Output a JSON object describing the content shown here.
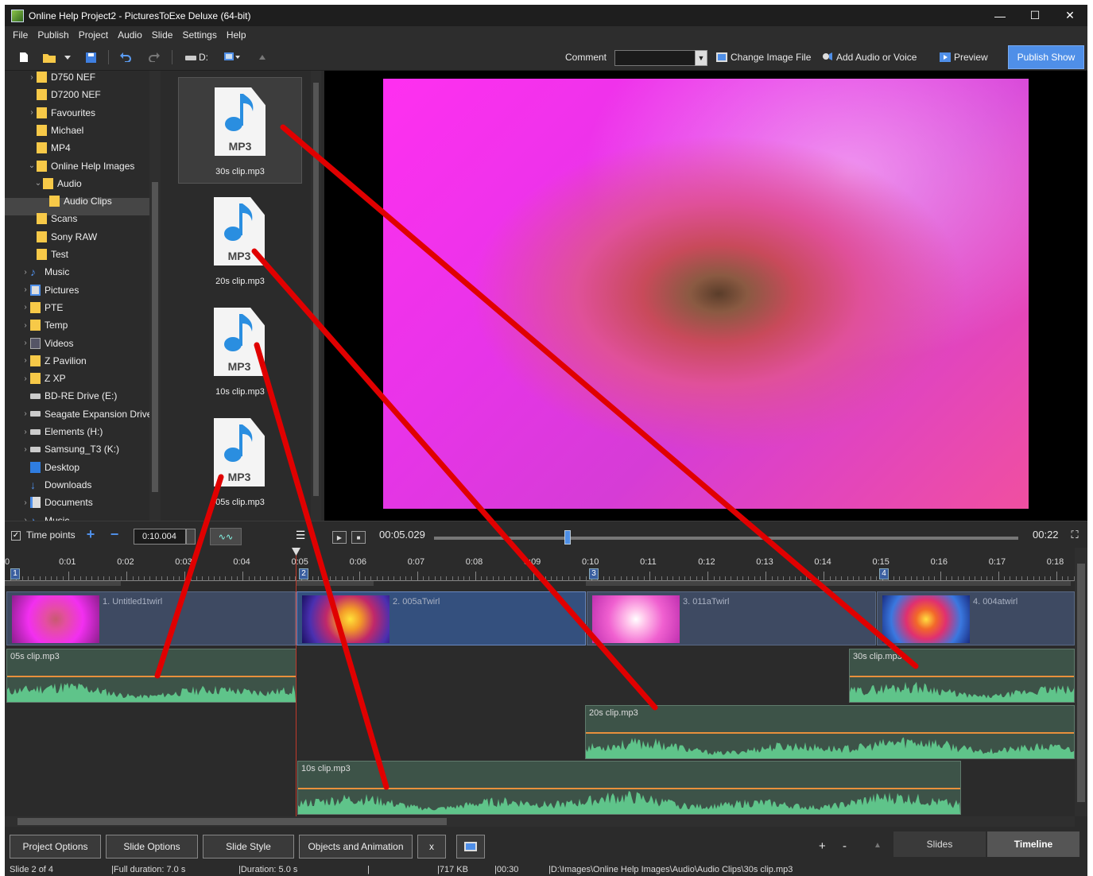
{
  "window": {
    "title": "Online Help Project2 - PicturesToExe Deluxe (64-bit)",
    "minimize": "—",
    "maximize": "☐",
    "close": "✕"
  },
  "menu": [
    "File",
    "Publish",
    "Project",
    "Audio",
    "Slide",
    "Settings",
    "Help"
  ],
  "toolbar": {
    "drive_label": "D:",
    "comment_label": "Comment",
    "comment_value": "",
    "change_image": "Change Image File",
    "add_audio": "Add Audio or Voice",
    "preview": "Preview",
    "publish": "Publish Show"
  },
  "tree": [
    {
      "label": "D750 NEF",
      "icon": "folder",
      "arrow": ">"
    },
    {
      "label": "D7200 NEF",
      "icon": "folder",
      "arrow": ""
    },
    {
      "label": "Favourites",
      "icon": "folder",
      "arrow": ">"
    },
    {
      "label": "Michael",
      "icon": "folder",
      "arrow": ""
    },
    {
      "label": "MP4",
      "icon": "folder",
      "arrow": ""
    },
    {
      "label": "Online Help Images",
      "icon": "folder",
      "arrow": "v"
    },
    {
      "label": "Audio",
      "icon": "folder",
      "arrow": "v"
    },
    {
      "label": "Audio Clips",
      "icon": "folder",
      "arrow": ""
    },
    {
      "label": "Scans",
      "icon": "folder",
      "arrow": ""
    },
    {
      "label": "Sony RAW",
      "icon": "folder",
      "arrow": ""
    },
    {
      "label": "Test",
      "icon": "folder",
      "arrow": ""
    },
    {
      "label": "Music",
      "icon": "music",
      "arrow": ">"
    },
    {
      "label": "Pictures",
      "icon": "pictures",
      "arrow": ">"
    },
    {
      "label": "PTE",
      "icon": "folder",
      "arrow": ">"
    },
    {
      "label": "Temp",
      "icon": "folder",
      "arrow": ">"
    },
    {
      "label": "Videos",
      "icon": "videos",
      "arrow": ">"
    },
    {
      "label": "Z Pavilion",
      "icon": "folder",
      "arrow": ">"
    },
    {
      "label": "Z XP",
      "icon": "folder",
      "arrow": ">"
    },
    {
      "label": "BD-RE Drive (E:)",
      "icon": "drive",
      "arrow": ""
    },
    {
      "label": "Seagate Expansion Drive...",
      "icon": "drive",
      "arrow": ">"
    },
    {
      "label": "Elements (H:)",
      "icon": "drive",
      "arrow": ">"
    },
    {
      "label": "Samsung_T3 (K:)",
      "icon": "drive",
      "arrow": ">"
    },
    {
      "label": "Desktop",
      "icon": "desktop",
      "arrow": ""
    },
    {
      "label": "Downloads",
      "icon": "downloads",
      "arrow": ""
    },
    {
      "label": "Documents",
      "icon": "documents",
      "arrow": ">"
    },
    {
      "label": "Music",
      "icon": "music",
      "arrow": ">"
    }
  ],
  "files": [
    {
      "name": "30s clip.mp3",
      "type": "MP3"
    },
    {
      "name": "20s clip.mp3",
      "type": "MP3"
    },
    {
      "name": "10s clip.mp3",
      "type": "MP3"
    },
    {
      "name": "05s clip.mp3",
      "type": "MP3"
    }
  ],
  "transport": {
    "time_points": "Time points",
    "time_value": "0:10.004",
    "current_time": "00:05.029",
    "total_time": "00:22",
    "seek_position": 0.229
  },
  "ruler": [
    "0",
    "0:01",
    "0:02",
    "0:03",
    "0:04",
    "0:05",
    "0:06",
    "0:07",
    "0:08",
    "0:09",
    "0:10",
    "0:11",
    "0:12",
    "0:13",
    "0:14",
    "0:15",
    "0:16",
    "0:17",
    "0:18"
  ],
  "slides": [
    {
      "number": "1",
      "label": "1. Untitled1twirl"
    },
    {
      "number": "2",
      "label": "2. 005aTwirl"
    },
    {
      "number": "3",
      "label": "3. 011aTwirl"
    },
    {
      "number": "4",
      "label": "4. 004atwirl"
    }
  ],
  "audio_clips": [
    {
      "name": "05s clip.mp3"
    },
    {
      "name": "30s clip.mp3"
    },
    {
      "name": "20s clip.mp3"
    },
    {
      "name": "10s clip.mp3"
    }
  ],
  "bottom": {
    "project_options": "Project Options",
    "slide_options": "Slide Options",
    "slide_style": "Slide Style",
    "objects_animation": "Objects and Animation",
    "x_button": "x",
    "plus": "+",
    "minus": "-",
    "slides_tab": "Slides",
    "timeline_tab": "Timeline"
  },
  "status": {
    "slide": "Slide 2 of 4",
    "full_duration": "Full duration: 7.0 s",
    "duration": "Duration: 5.0 s",
    "size": "717 KB",
    "time": "00:30",
    "path": "D:\\Images\\Online Help Images\\Audio\\Audio Clips\\30s clip.mp3"
  },
  "colors": {
    "accent": "#4f8fe8",
    "audio_volume": "#e8903c",
    "waveform": "#5fc48a",
    "annotation_arrow": "#e00000"
  }
}
